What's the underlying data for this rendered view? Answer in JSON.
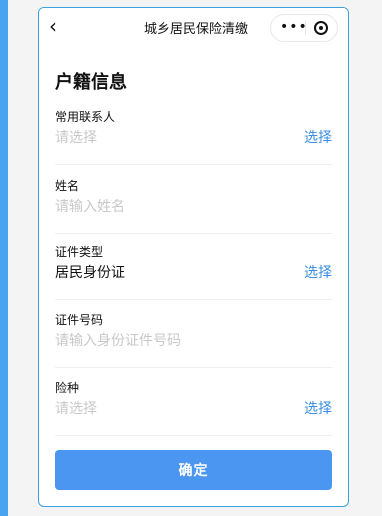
{
  "colors": {
    "accent": "#3b8ee6",
    "button": "#4a96f0",
    "left_strip": "#4aa3f0",
    "frame_border": "#3aa0e0",
    "placeholder": "#c8c8c8",
    "text": "#111111"
  },
  "header": {
    "back_icon": "chevron-left-icon",
    "title": "城乡居民保险清缴",
    "capsule": {
      "more_icon": "more-dots-icon",
      "close_icon": "circle-close-icon"
    }
  },
  "form": {
    "heading": "户籍信息",
    "fields": [
      {
        "label": "常用联系人",
        "value": "请选择",
        "filled": false,
        "action": "选择"
      },
      {
        "label": "姓名",
        "value": "请输入姓名",
        "filled": false,
        "action": ""
      },
      {
        "label": "证件类型",
        "value": "居民身份证",
        "filled": true,
        "action": "选择"
      },
      {
        "label": "证件号码",
        "value": "请输入身份证件号码",
        "filled": false,
        "action": ""
      },
      {
        "label": "险种",
        "value": "请选择",
        "filled": false,
        "action": "选择"
      }
    ],
    "confirm_label": "确定"
  }
}
